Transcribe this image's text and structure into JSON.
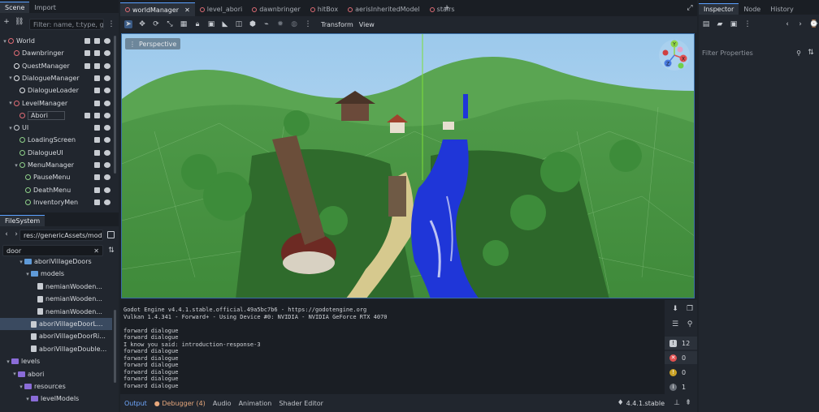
{
  "scene_dock": {
    "tabs": [
      "Scene",
      "Import"
    ],
    "filter_placeholder": "Filter: name, t:type, g:group",
    "tree": [
      {
        "name": "World",
        "indent": 0,
        "color": "#e06c75",
        "arrow": "▾"
      },
      {
        "name": "Dawnbringer",
        "indent": 1,
        "color": "#e06c75",
        "arrow": ""
      },
      {
        "name": "QuestManager",
        "indent": 1,
        "color": "#e6e8ec",
        "arrow": ""
      },
      {
        "name": "DialogueManager",
        "indent": 1,
        "color": "#e6e8ec",
        "arrow": "▾"
      },
      {
        "name": "DialogueLoader",
        "indent": 2,
        "color": "#e6e8ec",
        "arrow": ""
      },
      {
        "name": "LevelManager",
        "indent": 1,
        "color": "#e06c75",
        "arrow": "▾"
      },
      {
        "name": "Abori",
        "indent": 2,
        "color": "#e06c75",
        "arrow": ""
      },
      {
        "name": "UI",
        "indent": 1,
        "color": "#c8ccd2",
        "arrow": "▾"
      },
      {
        "name": "LoadingScreen",
        "indent": 2,
        "color": "#8fd18a",
        "arrow": ""
      },
      {
        "name": "DialogueUI",
        "indent": 2,
        "color": "#8fd18a",
        "arrow": ""
      },
      {
        "name": "MenuManager",
        "indent": 2,
        "color": "#8fd18a",
        "arrow": "▾"
      },
      {
        "name": "PauseMenu",
        "indent": 3,
        "color": "#8fd18a",
        "arrow": ""
      },
      {
        "name": "DeathMenu",
        "indent": 3,
        "color": "#8fd18a",
        "arrow": ""
      },
      {
        "name": "InventoryMen",
        "indent": 3,
        "color": "#8fd18a",
        "arrow": ""
      }
    ]
  },
  "filesystem": {
    "title": "FileSystem",
    "path": "res://genericAssets/model",
    "search": "door",
    "items": [
      {
        "name": "aboriVillageDoors",
        "indent": 2,
        "type": "folder",
        "arrow": "▾"
      },
      {
        "name": "models",
        "indent": 3,
        "type": "folder",
        "arrow": "▾"
      },
      {
        "name": "nemianWooden...",
        "indent": 4,
        "type": "file",
        "arrow": ""
      },
      {
        "name": "nemianWooden...",
        "indent": 4,
        "type": "file",
        "arrow": ""
      },
      {
        "name": "nemianWooden...",
        "indent": 4,
        "type": "file",
        "arrow": ""
      },
      {
        "name": "aboriVillageDoorL...",
        "indent": 3,
        "type": "file",
        "arrow": ""
      },
      {
        "name": "aboriVillageDoorRi...",
        "indent": 3,
        "type": "file",
        "arrow": ""
      },
      {
        "name": "aboriVillageDouble...",
        "indent": 3,
        "type": "file",
        "arrow": ""
      },
      {
        "name": "levels",
        "indent": 0,
        "type": "folder-purple",
        "arrow": "▾"
      },
      {
        "name": "abori",
        "indent": 1,
        "type": "folder-purple",
        "arrow": "▾"
      },
      {
        "name": "resources",
        "indent": 2,
        "type": "folder-purple",
        "arrow": "▾"
      },
      {
        "name": "levelModels",
        "indent": 3,
        "type": "folder-purple",
        "arrow": "▾"
      }
    ]
  },
  "editor_tabs": [
    "worldManager",
    "level_abori",
    "dawnbringer",
    "hitBox",
    "aerisInheritedModel",
    "stairs"
  ],
  "toolbar": {
    "transform": "Transform",
    "view": "View"
  },
  "viewport": {
    "perspective_label": "Perspective",
    "gizmo": {
      "y": "Y",
      "x": "X",
      "z": "Z"
    }
  },
  "console": {
    "lines": [
      "Godot Engine v4.4.1.stable.official.49a5bc7b6 - https://godotengine.org",
      "Vulkan 1.4.341 - Forward+ - Using Device #0: NVIDIA - NVIDIA GeForce RTX 4070",
      "",
      "forward dialogue",
      "forward dialogue",
      "I know you said: introduction-response-3",
      "forward dialogue",
      "forward dialogue",
      "forward dialogue",
      "forward dialogue",
      "forward dialogue",
      "forward dialogue"
    ],
    "counts": {
      "messages": "12",
      "errors": "0",
      "warnings": "0",
      "other": "1"
    }
  },
  "bottom_tabs": [
    "Output",
    "Debugger (4)",
    "Audio",
    "Animation",
    "Shader Editor"
  ],
  "version": "4.4.1.stable",
  "inspector": {
    "tabs": [
      "Inspector",
      "Node",
      "History"
    ],
    "filter_placeholder": "Filter Properties"
  }
}
